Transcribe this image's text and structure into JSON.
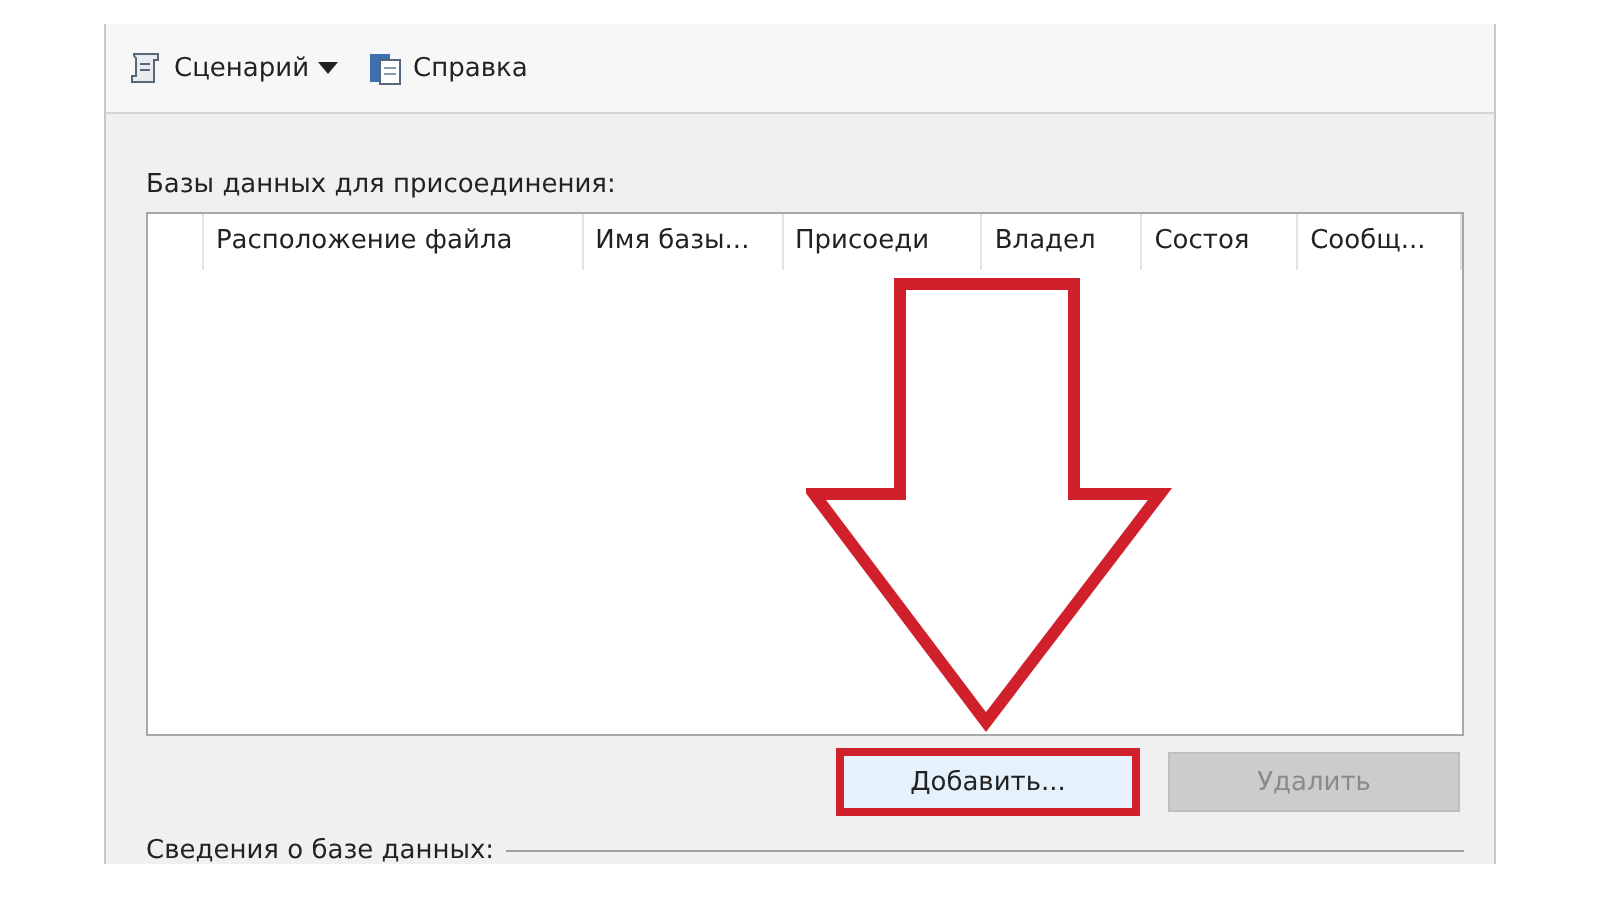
{
  "toolbar": [
    {
      "label": "Сценарий",
      "kind": "script",
      "dropdown": true
    },
    {
      "label": "Справка",
      "kind": "help",
      "dropdown": false
    }
  ],
  "databases_label": "Базы данных для присоединения:",
  "table": {
    "columns": [
      "",
      "Расположение файла",
      "Имя базы...",
      "Присоеди",
      "Владел",
      "Состоя",
      "Сообщ..."
    ]
  },
  "buttons": [
    {
      "label": "Добавить...",
      "disabled": false,
      "highlighted": true
    },
    {
      "label": "Удалить",
      "disabled": true,
      "highlighted": false
    }
  ],
  "details_label": "Сведения о базе данных:",
  "annotation": {
    "kind": "down-arrow"
  }
}
